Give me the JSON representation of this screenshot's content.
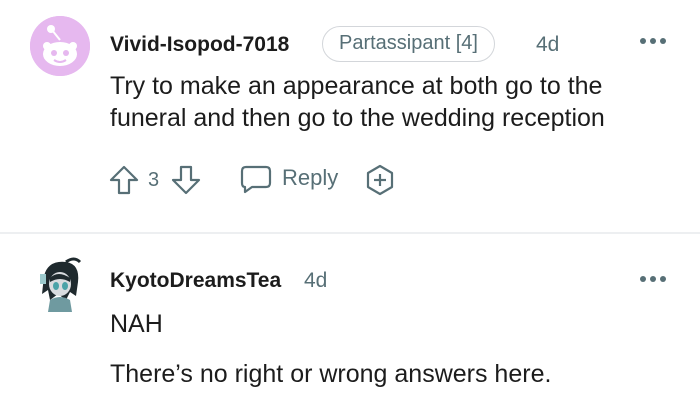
{
  "comments": [
    {
      "username": "Vivid-Isopod-7018",
      "flair": "Partassipant [4]",
      "time": "4d",
      "lines": [
        "Try to make an appearance at both go to the funeral and then go to the wedding reception"
      ],
      "score": "3",
      "reply_label": "Reply"
    },
    {
      "username": "KyotoDreamsTea",
      "time": "4d",
      "lines": [
        "NAH",
        "There’s no right or wrong answers here."
      ]
    }
  ],
  "icons": [
    "snoo-avatar",
    "anime-avatar",
    "more-options-icon",
    "upvote-icon",
    "downvote-icon",
    "reply-icon",
    "award-icon"
  ],
  "colors": {
    "avatar_bg": "#e6b8ef",
    "meta_text": "#576f76",
    "flair_border": "#d3d6da"
  }
}
